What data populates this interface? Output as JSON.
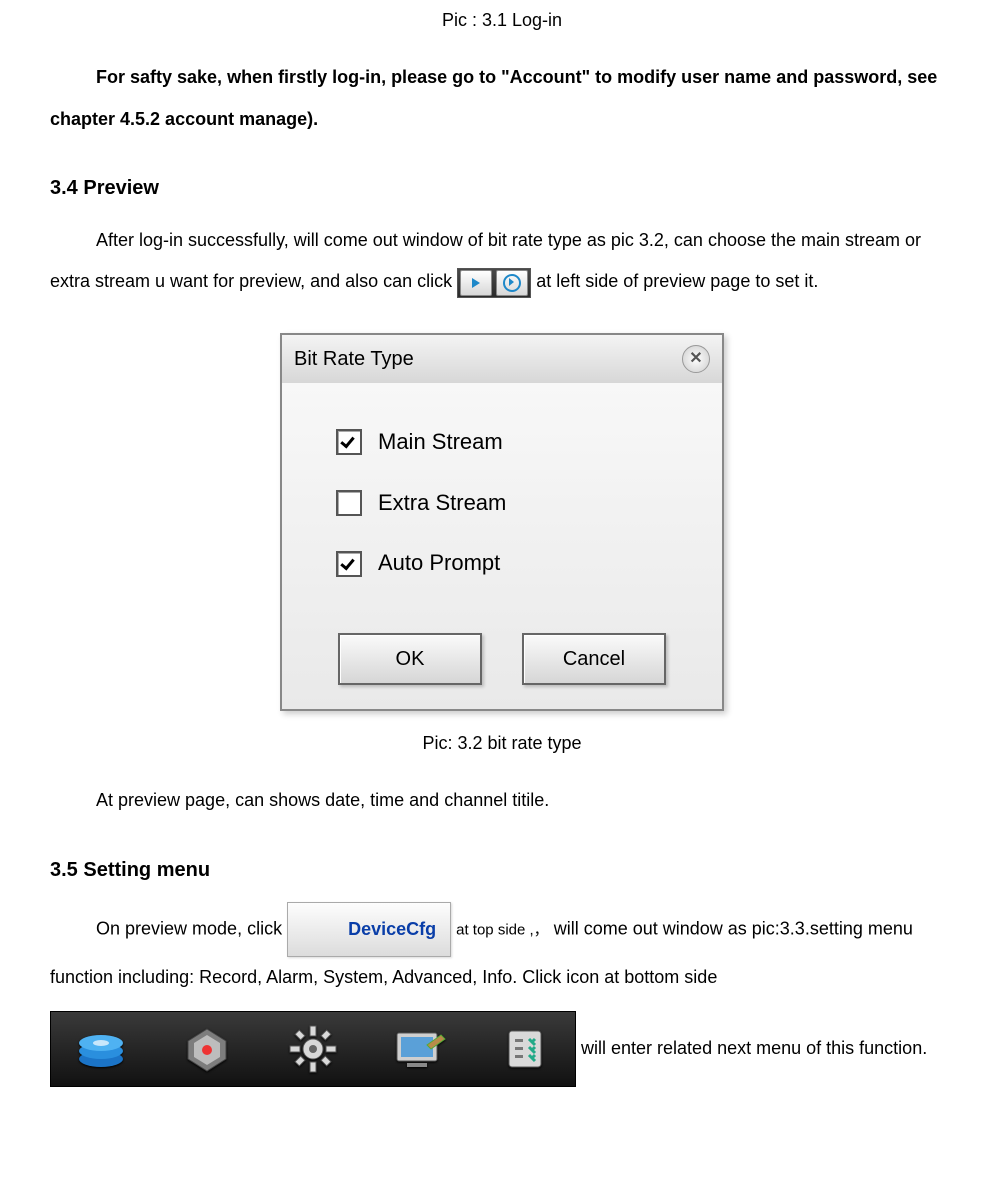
{
  "caption1": "Pic : 3.1 Log-in",
  "safety_note": "For safty sake, when firstly log-in, please go to \"Account\" to modify user name and password, see chapter 4.5.2 account manage).",
  "sec34_title": "3.4 Preview",
  "sec34_p1a": "After log-in successfully, will come out window of bit rate type as pic 3.2, can choose the main stream or extra stream u want for preview, and also can click ",
  "sec34_p1b": " at left side of preview page to set it.",
  "dialog": {
    "title": "Bit Rate Type",
    "opt1": "Main Stream",
    "opt2": "Extra Stream",
    "opt3": "Auto Prompt",
    "ok": "OK",
    "cancel": "Cancel"
  },
  "caption2": "Pic: 3.2 bit rate type",
  "sec34_p2": "At preview page, can shows date, time and channel titile.",
  "sec35_title": "3.5 Setting menu",
  "sec35_p1a": "On preview mode, click ",
  "devcfg_label": "DeviceCfg",
  "sec35_p1b_small": " at top side ,，",
  "sec35_p1c": "will come out window as pic:3.3.setting menu function including: Record, Alarm, System, Advanced, Info. Click icon at bottom side",
  "sec35_tail": "will enter related next menu of this function."
}
